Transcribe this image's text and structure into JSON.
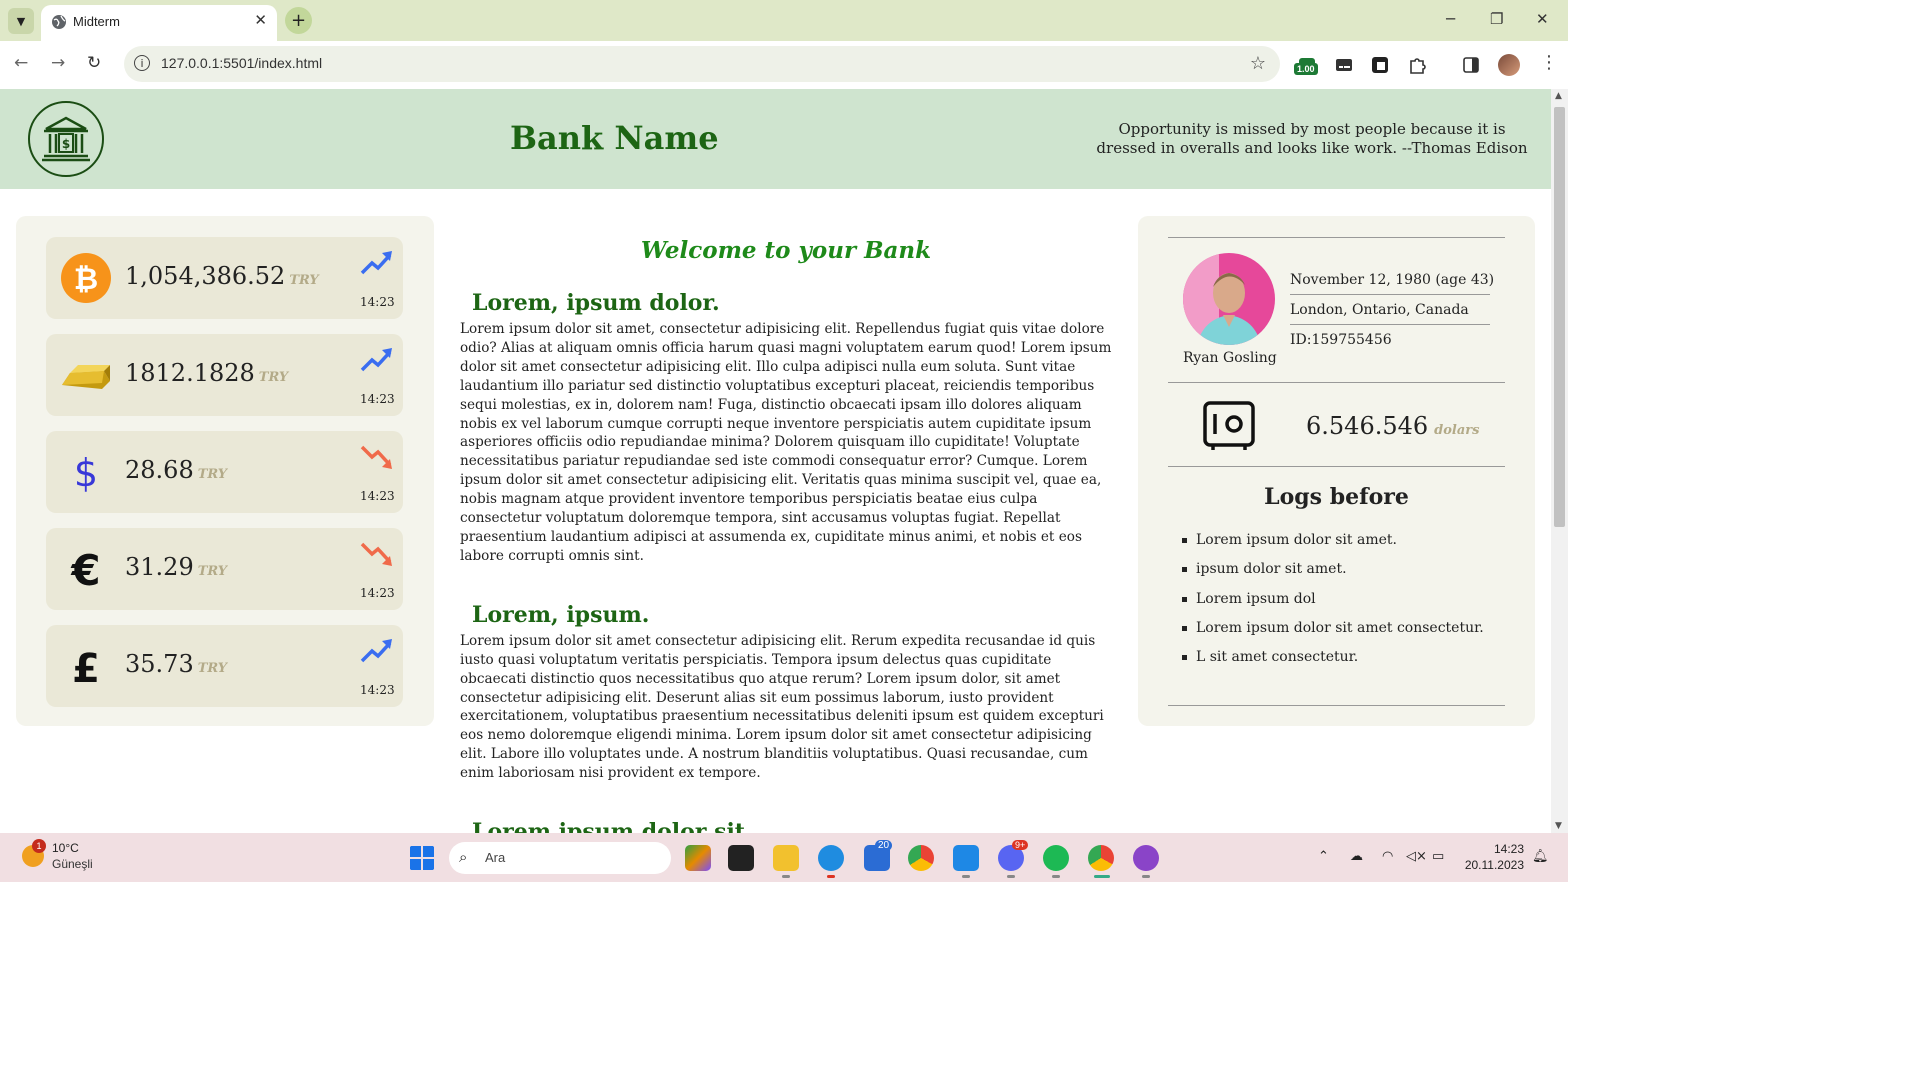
{
  "browser": {
    "tab_title": "Midterm",
    "url": "127.0.0.1:5501/index.html",
    "extension_badge": "1.00"
  },
  "header": {
    "bank_name": "Bank Name",
    "quote": "Opportunity is missed by most people because it is dressed in overalls and looks like work. --Thomas Edison"
  },
  "rates": [
    {
      "icon": "bitcoin-icon",
      "value": "1,054,386.52",
      "unit": "TRY",
      "trend": "up",
      "time": "14:23"
    },
    {
      "icon": "gold-bar-icon",
      "value": "1812.1828",
      "unit": "TRY",
      "trend": "up",
      "time": "14:23"
    },
    {
      "icon": "dollar-icon",
      "value": "28.68",
      "unit": "TRY",
      "trend": "down",
      "time": "14:23"
    },
    {
      "icon": "euro-icon",
      "value": "31.29",
      "unit": "TRY",
      "trend": "down",
      "time": "14:23"
    },
    {
      "icon": "pound-icon",
      "value": "35.73",
      "unit": "TRY",
      "trend": "up",
      "time": "14:23"
    }
  ],
  "main": {
    "welcome": "Welcome to your Bank",
    "sections": [
      {
        "heading": "Lorem, ipsum dolor.",
        "text": "Lorem ipsum dolor sit amet, consectetur adipisicing elit. Repellendus fugiat quis vitae dolore odio? Alias at aliquam omnis officia harum quasi magni voluptatem earum quod! Lorem ipsum dolor sit amet consectetur adipisicing elit. Illo culpa adipisci nulla eum soluta. Sunt vitae laudantium illo pariatur sed distinctio voluptatibus excepturi placeat, reiciendis temporibus sequi molestias, ex in, dolorem nam! Fuga, distinctio obcaecati ipsam illo dolores aliquam nobis ex vel laborum cumque corrupti neque inventore perspiciatis autem cupiditate ipsum asperiores officiis odio repudiandae minima? Dolorem quisquam illo cupiditate! Voluptate necessitatibus pariatur repudiandae sed iste commodi consequatur error? Cumque. Lorem ipsum dolor sit amet consectetur adipisicing elit. Veritatis quas minima suscipit vel, quae ea, nobis magnam atque provident inventore temporibus perspiciatis beatae eius culpa consectetur voluptatum doloremque tempora, sint accusamus voluptas fugiat. Repellat praesentium laudantium adipisci at assumenda ex, cupiditate minus animi, et nobis et eos labore corrupti omnis sint."
      },
      {
        "heading": "Lorem, ipsum.",
        "text": "Lorem ipsum dolor sit amet consectetur adipisicing elit. Rerum expedita recusandae id quis iusto quasi voluptatum veritatis perspiciatis. Tempora ipsum delectus quas cupiditate obcaecati distinctio quos necessitatibus quo atque rerum? Lorem ipsum dolor, sit amet consectetur adipisicing elit. Deserunt alias sit eum possimus laborum, iusto provident exercitationem, voluptatibus praesentium necessitatibus deleniti ipsum est quidem excepturi eos nemo doloremque eligendi minima. Lorem ipsum dolor sit amet consectetur adipisicing elit. Labore illo voluptates unde. A nostrum blanditiis voluptatibus. Quasi recusandae, cum enim laboriosam nisi provident ex tempore."
      },
      {
        "heading": "Lorem ipsum dolor sit.",
        "text": ""
      }
    ]
  },
  "profile": {
    "name": "Ryan Gosling",
    "birth": "November 12, 1980 (age 43)",
    "location": "London, Ontario, Canada",
    "id": "ID:159755456",
    "balance": "6.546.546",
    "balance_unit": "dolars",
    "logs_title": "Logs before",
    "logs": [
      "Lorem ipsum dolor sit amet.",
      "ipsum dolor sit amet.",
      "Lorem ipsum dol",
      "Lorem ipsum dolor sit amet consectetur.",
      "L sit amet consectetur."
    ]
  },
  "taskbar": {
    "weather_temp": "10°C",
    "weather_desc": "Güneşli",
    "weather_badge": "1",
    "search_placeholder": "Ara",
    "teams_badge": "20",
    "discord_badge": "9+",
    "time": "14:23",
    "date": "20.11.2023"
  },
  "colors": {
    "header_bg": "#cfe4cf",
    "brand_green": "#1d6514",
    "welcome_green": "#1e8a1a",
    "card_bg": "#eae8d7",
    "panel_bg": "#f4f4ec",
    "unit_tan": "#b3aa88",
    "trend_up": "#3a6df0",
    "trend_down": "#f06a4a"
  }
}
